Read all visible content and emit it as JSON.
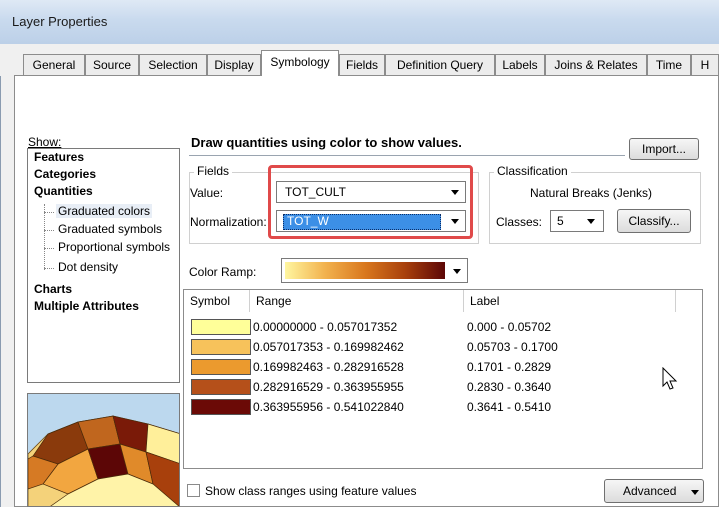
{
  "window": {
    "title": "Layer Properties"
  },
  "tabs": [
    {
      "label": "General"
    },
    {
      "label": "Source"
    },
    {
      "label": "Selection"
    },
    {
      "label": "Display"
    },
    {
      "label": "Symbology"
    },
    {
      "label": "Fields"
    },
    {
      "label": "Definition Query"
    },
    {
      "label": "Labels"
    },
    {
      "label": "Joins & Relates"
    },
    {
      "label": "Time"
    },
    {
      "label": "H"
    }
  ],
  "active_tab": "Symbology",
  "show": {
    "label": "Show:",
    "items": [
      {
        "label": "Features"
      },
      {
        "label": "Categories"
      },
      {
        "label": "Quantities"
      },
      {
        "label": "Graduated colors"
      },
      {
        "label": "Graduated symbols"
      },
      {
        "label": "Proportional symbols"
      },
      {
        "label": "Dot density"
      },
      {
        "label": "Charts"
      },
      {
        "label": "Multiple Attributes"
      }
    ],
    "selected": "Graduated colors"
  },
  "header": {
    "description": "Draw quantities using color to show values.",
    "import_label": "Import..."
  },
  "fields": {
    "group_label": "Fields",
    "value_label": "Value:",
    "value": "TOT_CULT",
    "normalization_label": "Normalization:",
    "normalization": "TOT_W"
  },
  "classification": {
    "group_label": "Classification",
    "method": "Natural Breaks (Jenks)",
    "classes_label": "Classes:",
    "classes": "5",
    "classify_label": "Classify..."
  },
  "color_ramp": {
    "label": "Color Ramp:",
    "colors": [
      "#fff6a0",
      "#f2b24e",
      "#d9781e",
      "#a8400c",
      "#5c0606"
    ]
  },
  "table": {
    "headers": {
      "symbol": "Symbol",
      "range": "Range",
      "label": "Label"
    },
    "rows": [
      {
        "color": "#ffff99",
        "range": "0.00000000 - 0.057017352",
        "label": "0.000 - 0.05702"
      },
      {
        "color": "#f7c25b",
        "range": "0.057017353 - 0.169982462",
        "label": "0.05703 - 0.1700"
      },
      {
        "color": "#eb9a2e",
        "range": "0.169982463 - 0.282916528",
        "label": "0.1701 - 0.2829"
      },
      {
        "color": "#b5501a",
        "range": "0.282916529 - 0.363955955",
        "label": "0.2830 - 0.3640"
      },
      {
        "color": "#6b0a06",
        "range": "0.363955956 - 0.541022840",
        "label": "0.3641 - 0.5410"
      }
    ]
  },
  "footer": {
    "show_ranges_label": "Show class ranges using feature values",
    "advanced_label": "Advanced"
  },
  "colors": {
    "highlight": "#e04a4a",
    "selection": "#3c8fe6"
  }
}
